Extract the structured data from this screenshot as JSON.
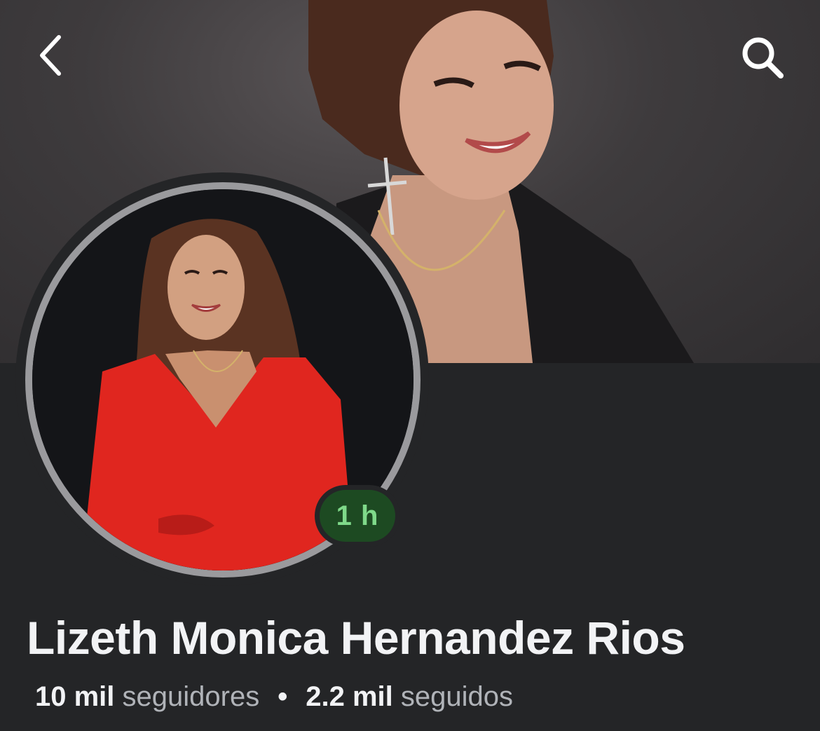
{
  "header": {
    "back_icon": "chevron-left-icon",
    "search_icon": "search-icon"
  },
  "profile": {
    "name": "Lizeth Monica Hernandez Rios",
    "story_badge": "1 h",
    "badge_color": "#7fd98a",
    "followers_count": "10 mil",
    "followers_label": "seguidores",
    "separator": "•",
    "following_count": "2.2 mil",
    "following_label": "seguidos"
  },
  "colors": {
    "background": "#242527",
    "text_primary": "#f2f3f5",
    "text_secondary": "#b0b3b8",
    "badge_bg": "#1d4a22"
  }
}
